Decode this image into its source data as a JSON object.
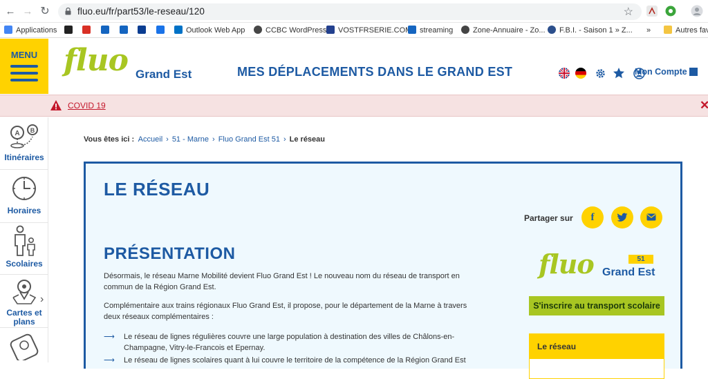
{
  "browser": {
    "url": "fluo.eu/fr/part53/le-reseau/120",
    "bookmarks": [
      {
        "label": "Applications",
        "color": "#4285f4"
      },
      {
        "label": "",
        "color": "#222222"
      },
      {
        "label": "",
        "color": "#d93025"
      },
      {
        "label": "",
        "color": "#1565c0"
      },
      {
        "label": "",
        "color": "#1565c0"
      },
      {
        "label": "",
        "color": "#0b3d91"
      },
      {
        "label": "",
        "color": "#1a73e8"
      },
      {
        "label": "Outlook Web App",
        "color": "#0072c6"
      },
      {
        "label": "CCBC WordPress",
        "color": "#464646"
      },
      {
        "label": "VOSTFRSERIE.COM",
        "color": "#23408e"
      },
      {
        "label": "streaming",
        "color": "#1565c0"
      },
      {
        "label": "Zone-Annuaire - Zo...",
        "color": "#444444"
      },
      {
        "label": "F.B.I. - Saison 1 » Z...",
        "color": "#2c4f8c"
      },
      {
        "label": "»",
        "color": ""
      },
      {
        "label": "Autres fav",
        "color": "#f4c542"
      }
    ]
  },
  "header": {
    "menu_label": "MENU",
    "logo_text": "fluo",
    "logo_sub": "Grand Est",
    "tagline": "MES DÉPLACEMENTS DANS LE GRAND EST",
    "account_label": "Mon Compte",
    "accent": "#ffd200",
    "brand_blue": "#1d5aa3",
    "brand_green": "#a8c622"
  },
  "covid": {
    "label": "COVID 19",
    "close": "✕"
  },
  "rail": [
    {
      "label": "Itinéraires",
      "icon": "route-icon"
    },
    {
      "label": "Horaires",
      "icon": "clock-icon"
    },
    {
      "label": "Scolaires",
      "icon": "family-icon"
    },
    {
      "label": "Cartes et plans",
      "icon": "map-pin-icon"
    }
  ],
  "breadcrumb": {
    "lead": "Vous êtes ici :",
    "items": [
      "Accueil",
      "51 - Marne",
      "Fluo Grand Est 51"
    ],
    "current": "Le réseau"
  },
  "main": {
    "title": "LE RÉSEAU",
    "share_label": "Partager sur",
    "section_title": "PRÉSENTATION",
    "para1": "Désormais, le réseau Marne Mobilité devient Fluo Grand Est ! Le nouveau nom du réseau de transport en commun de la Région Grand Est.",
    "para2": "Complémentaire aux trains régionaux Fluo Grand Est, il propose, pour le département de la Marne à travers deux réseaux complémentaires :",
    "bullets": [
      "Le réseau de lignes régulières couvre une large population à destination des villes de Châlons-en-Champagne, Vitry-le-Francois et Epernay.",
      "Le réseau de lignes scolaires quant à lui couvre le territoire de la compétence de la Région Grand Est"
    ],
    "arrow": "⟶",
    "logo_text": "fluo",
    "logo_sub": "Grand Est",
    "logo_num": "51",
    "cta_label": "S'inscrire au transport scolaire",
    "side_box_title": "Le réseau"
  }
}
